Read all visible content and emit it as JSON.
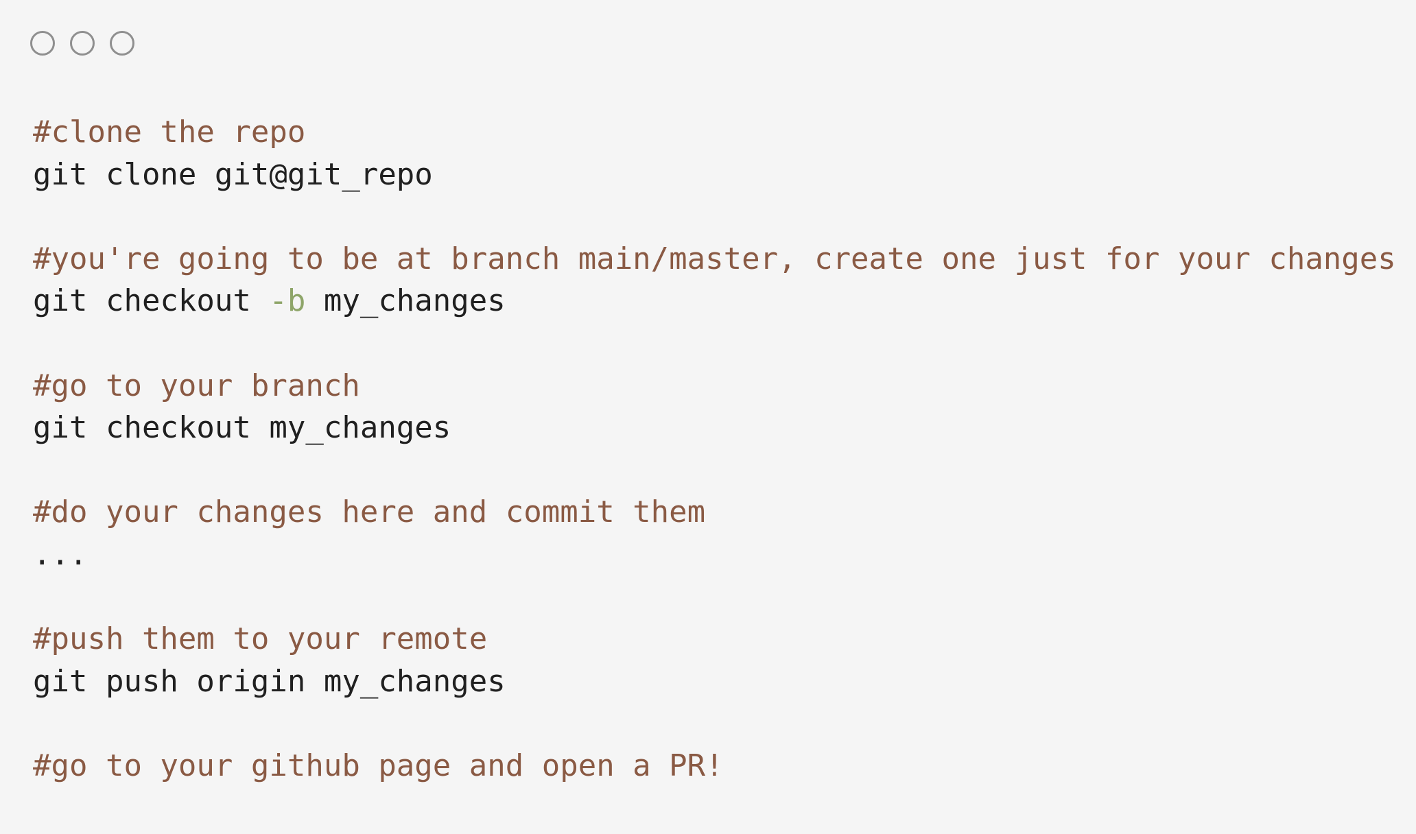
{
  "window": {
    "controls": [
      {
        "icon": "circle-outline-icon"
      },
      {
        "icon": "circle-outline-icon"
      },
      {
        "icon": "circle-outline-icon"
      }
    ]
  },
  "code": {
    "lines": [
      {
        "type": "comment",
        "text": "#clone the repo"
      },
      {
        "type": "command",
        "text": "git clone git@git_repo"
      },
      {
        "type": "blank",
        "text": ""
      },
      {
        "type": "comment",
        "text": "#you're going to be at branch main/master, create one just for your changes"
      },
      {
        "type": "command",
        "parts": [
          "git checkout ",
          "-b",
          " my_changes"
        ]
      },
      {
        "type": "blank",
        "text": ""
      },
      {
        "type": "comment",
        "text": "#go to your branch"
      },
      {
        "type": "command",
        "text": "git checkout my_changes"
      },
      {
        "type": "blank",
        "text": ""
      },
      {
        "type": "comment",
        "text": "#do your changes here and commit them"
      },
      {
        "type": "command",
        "text": "..."
      },
      {
        "type": "blank",
        "text": ""
      },
      {
        "type": "comment",
        "text": "#push them to your remote"
      },
      {
        "type": "command",
        "text": "git push origin my_changes"
      },
      {
        "type": "blank",
        "text": ""
      },
      {
        "type": "comment",
        "text": "#go to your github page and open a PR!"
      }
    ]
  },
  "colors": {
    "background": "#f5f5f5",
    "comment": "#8a5a44",
    "command": "#202020",
    "flag": "#8ea569",
    "window_control": "#8f8f8f"
  }
}
